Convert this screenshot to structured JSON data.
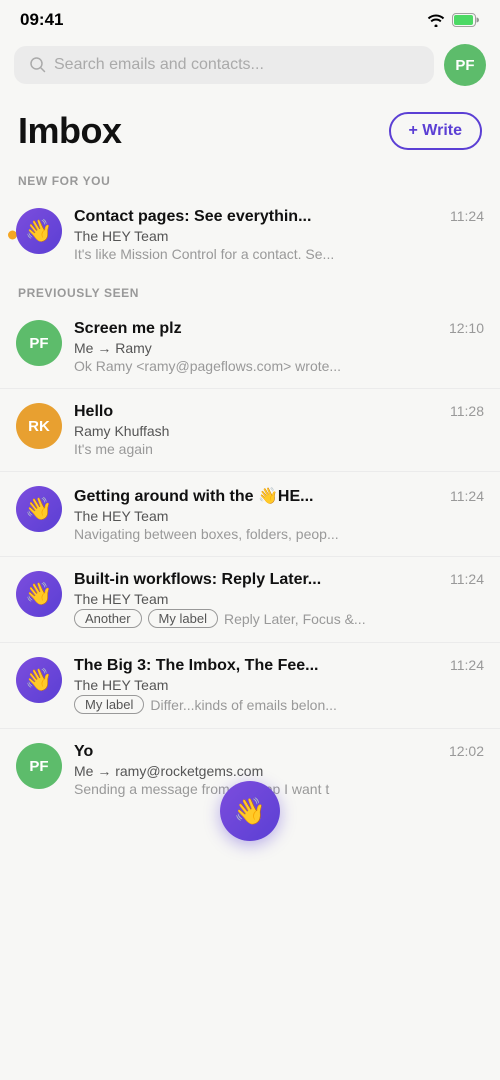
{
  "statusBar": {
    "time": "09:41"
  },
  "search": {
    "placeholder": "Search emails and contacts..."
  },
  "avatar": {
    "initials": "PF",
    "label": "User avatar PF"
  },
  "header": {
    "title": "Imbox",
    "writeButton": "+ Write"
  },
  "sections": {
    "newForYou": "NEW FOR YOU",
    "previouslySeen": "PREVIOUSLY SEEN"
  },
  "emails": {
    "newEmails": [
      {
        "id": "email-1",
        "avatarType": "hey",
        "subject": "Contact pages: See everythin...",
        "time": "11:24",
        "sender": "The HEY Team",
        "preview": "It's like Mission Control for a contact. Se...",
        "unread": true
      }
    ],
    "previousEmails": [
      {
        "id": "email-2",
        "avatarType": "pf",
        "avatarInitials": "PF",
        "subject": "Screen me plz",
        "time": "12:10",
        "sender": "Me → Ramy",
        "preview": "Ok Ramy <ramy@pageflows.com> wrote...",
        "unread": false
      },
      {
        "id": "email-3",
        "avatarType": "rk",
        "avatarInitials": "RK",
        "subject": "Hello",
        "time": "11:28",
        "sender": "Ramy Khuffash",
        "preview": "It's me again",
        "unread": false
      },
      {
        "id": "email-4",
        "avatarType": "hey",
        "subject": "Getting around with the 👋HE...",
        "time": "11:24",
        "sender": "The HEY Team",
        "preview": "Navigating between boxes, folders, peop...",
        "unread": false
      },
      {
        "id": "email-5",
        "avatarType": "hey",
        "subject": "Built-in workflows: Reply Later...",
        "time": "11:24",
        "sender": "The HEY Team",
        "tags": [
          "Another",
          "My label"
        ],
        "tagsPreview": " Reply Later, Focus &...",
        "unread": false
      },
      {
        "id": "email-6",
        "avatarType": "hey",
        "subject": "The Big 3: The Imbox, The Fee...",
        "time": "11:24",
        "sender": "The HEY Team",
        "tags": [
          "My label"
        ],
        "tagsPreview": " Differ...kinds of emails belon...",
        "unread": false
      },
      {
        "id": "email-7",
        "avatarType": "pf",
        "avatarInitials": "PF",
        "subject": "Yo",
        "time": "12:02",
        "sender": "Me → ramy@rocketgems.com",
        "preview": "Sending a message from the app I want t",
        "unread": false,
        "partial": true
      }
    ]
  },
  "fab": {
    "icon": "👋",
    "label": "HEY floating action button"
  }
}
